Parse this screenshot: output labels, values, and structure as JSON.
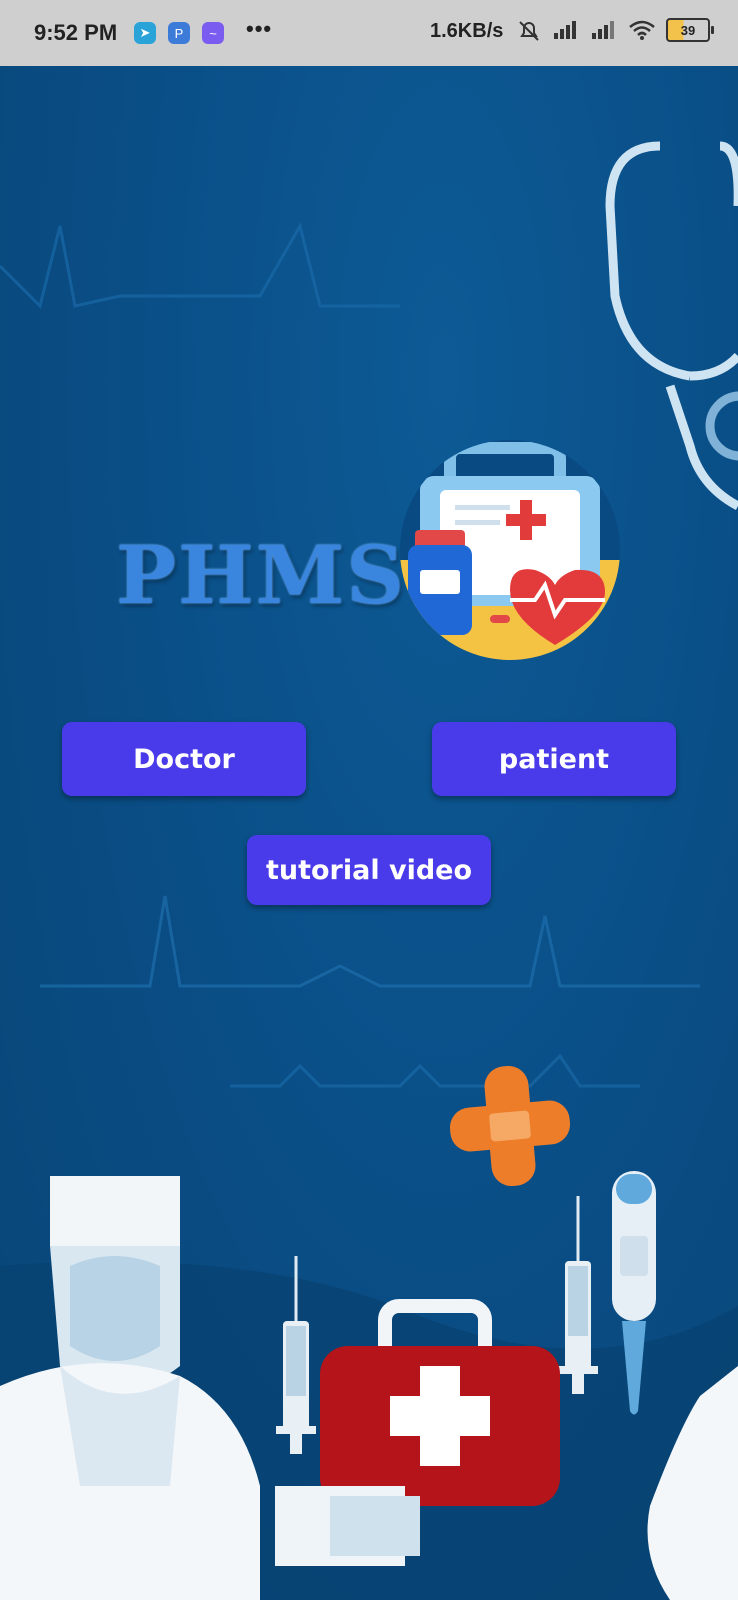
{
  "status_bar": {
    "time": "9:52 PM",
    "more": "•••",
    "net_speed": "1.6KB/s",
    "battery_level": "39",
    "apps": [
      "telegram-icon",
      "pay-app-icon",
      "messenger-icon"
    ]
  },
  "app": {
    "brand": "PHMS",
    "colors": {
      "background": "#0a4e86",
      "button": "#4a3bea",
      "brand_text": "#3a86de"
    }
  },
  "buttons": {
    "doctor": "Doctor",
    "patient": "patient",
    "tutorial": "tutorial video"
  }
}
